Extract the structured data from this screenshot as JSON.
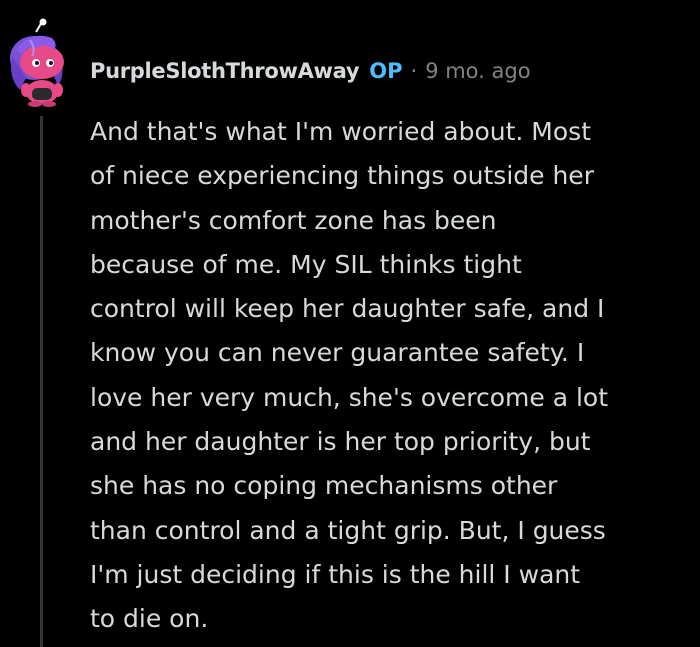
{
  "comment": {
    "author": "PurpleSlothThrowAway",
    "op_badge": "OP",
    "separator": "·",
    "timestamp": "9 mo. ago",
    "avatar_icon": "snoo-avatar-icon",
    "body_lines": [
      "And that's what I'm worried about. Most",
      "of niece experiencing things outside her",
      "mother's comfort zone has been",
      "because of me. My SIL thinks tight",
      "control will keep her daughter safe, and I",
      "know you can never guarantee safety. I",
      "love her very much, she's overcome a lot",
      "and her daughter is her top priority, but",
      "she has no coping mechanisms other",
      "than control and a tight grip. But, I guess",
      "I'm just deciding if this is the hill I want",
      "to die on."
    ]
  },
  "colors": {
    "background": "#000000",
    "text": "#d7dadc",
    "op_badge": "#4fbcff",
    "muted": "#818384",
    "thread_line": "#343536"
  }
}
